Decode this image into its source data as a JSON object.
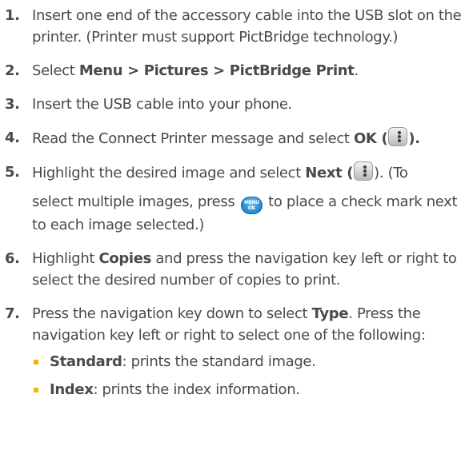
{
  "steps": [
    {
      "num": "1.",
      "text": "Insert one end of the accessory cable into the USB slot on the printer. (Printer must support PictBridge technology.)"
    },
    {
      "num": "2.",
      "prefix": "Select ",
      "menu": "Menu",
      "sep1": " > ",
      "pictures": "Pictures",
      "sep2": " > ",
      "pictbridge": "PictBridge Print",
      "suffix": "."
    },
    {
      "num": "3.",
      "text": "Insert the USB cable into your phone."
    },
    {
      "num": "4.",
      "prefix": "Read the Connect Printer message and select ",
      "ok": "OK",
      "open": " (",
      "close": ")."
    },
    {
      "num": "5.",
      "prefix": "Highlight the desired image and select ",
      "next": "Next",
      "open": " (",
      "close": "). (To",
      "line2_prefix": "select multiple images, press ",
      "menu_key_top": "MENU",
      "menu_key_bottom": "OK",
      "line2_suffix": " to place a check mark next to each image selected.)"
    },
    {
      "num": "6.",
      "prefix": "Highlight ",
      "copies": "Copies",
      "suffix": " and press the navigation key left or right to select the desired number of copies to print."
    },
    {
      "num": "7.",
      "prefix": "Press the navigation key down to select ",
      "type": "Type",
      "suffix": ". Press the navigation key left or right to select one of the following:",
      "options": [
        {
          "label": "Standard",
          "desc": ": prints the standard image."
        },
        {
          "label": "Index",
          "desc": ": prints the index information."
        }
      ]
    }
  ],
  "icons": {
    "softkey": "right-softkey-icon",
    "menu_ok": "menu-ok-key-icon"
  },
  "colors": {
    "text": "#4a4a4a",
    "bullet": "#f2b705",
    "menu_key": "#2b8fd4"
  }
}
